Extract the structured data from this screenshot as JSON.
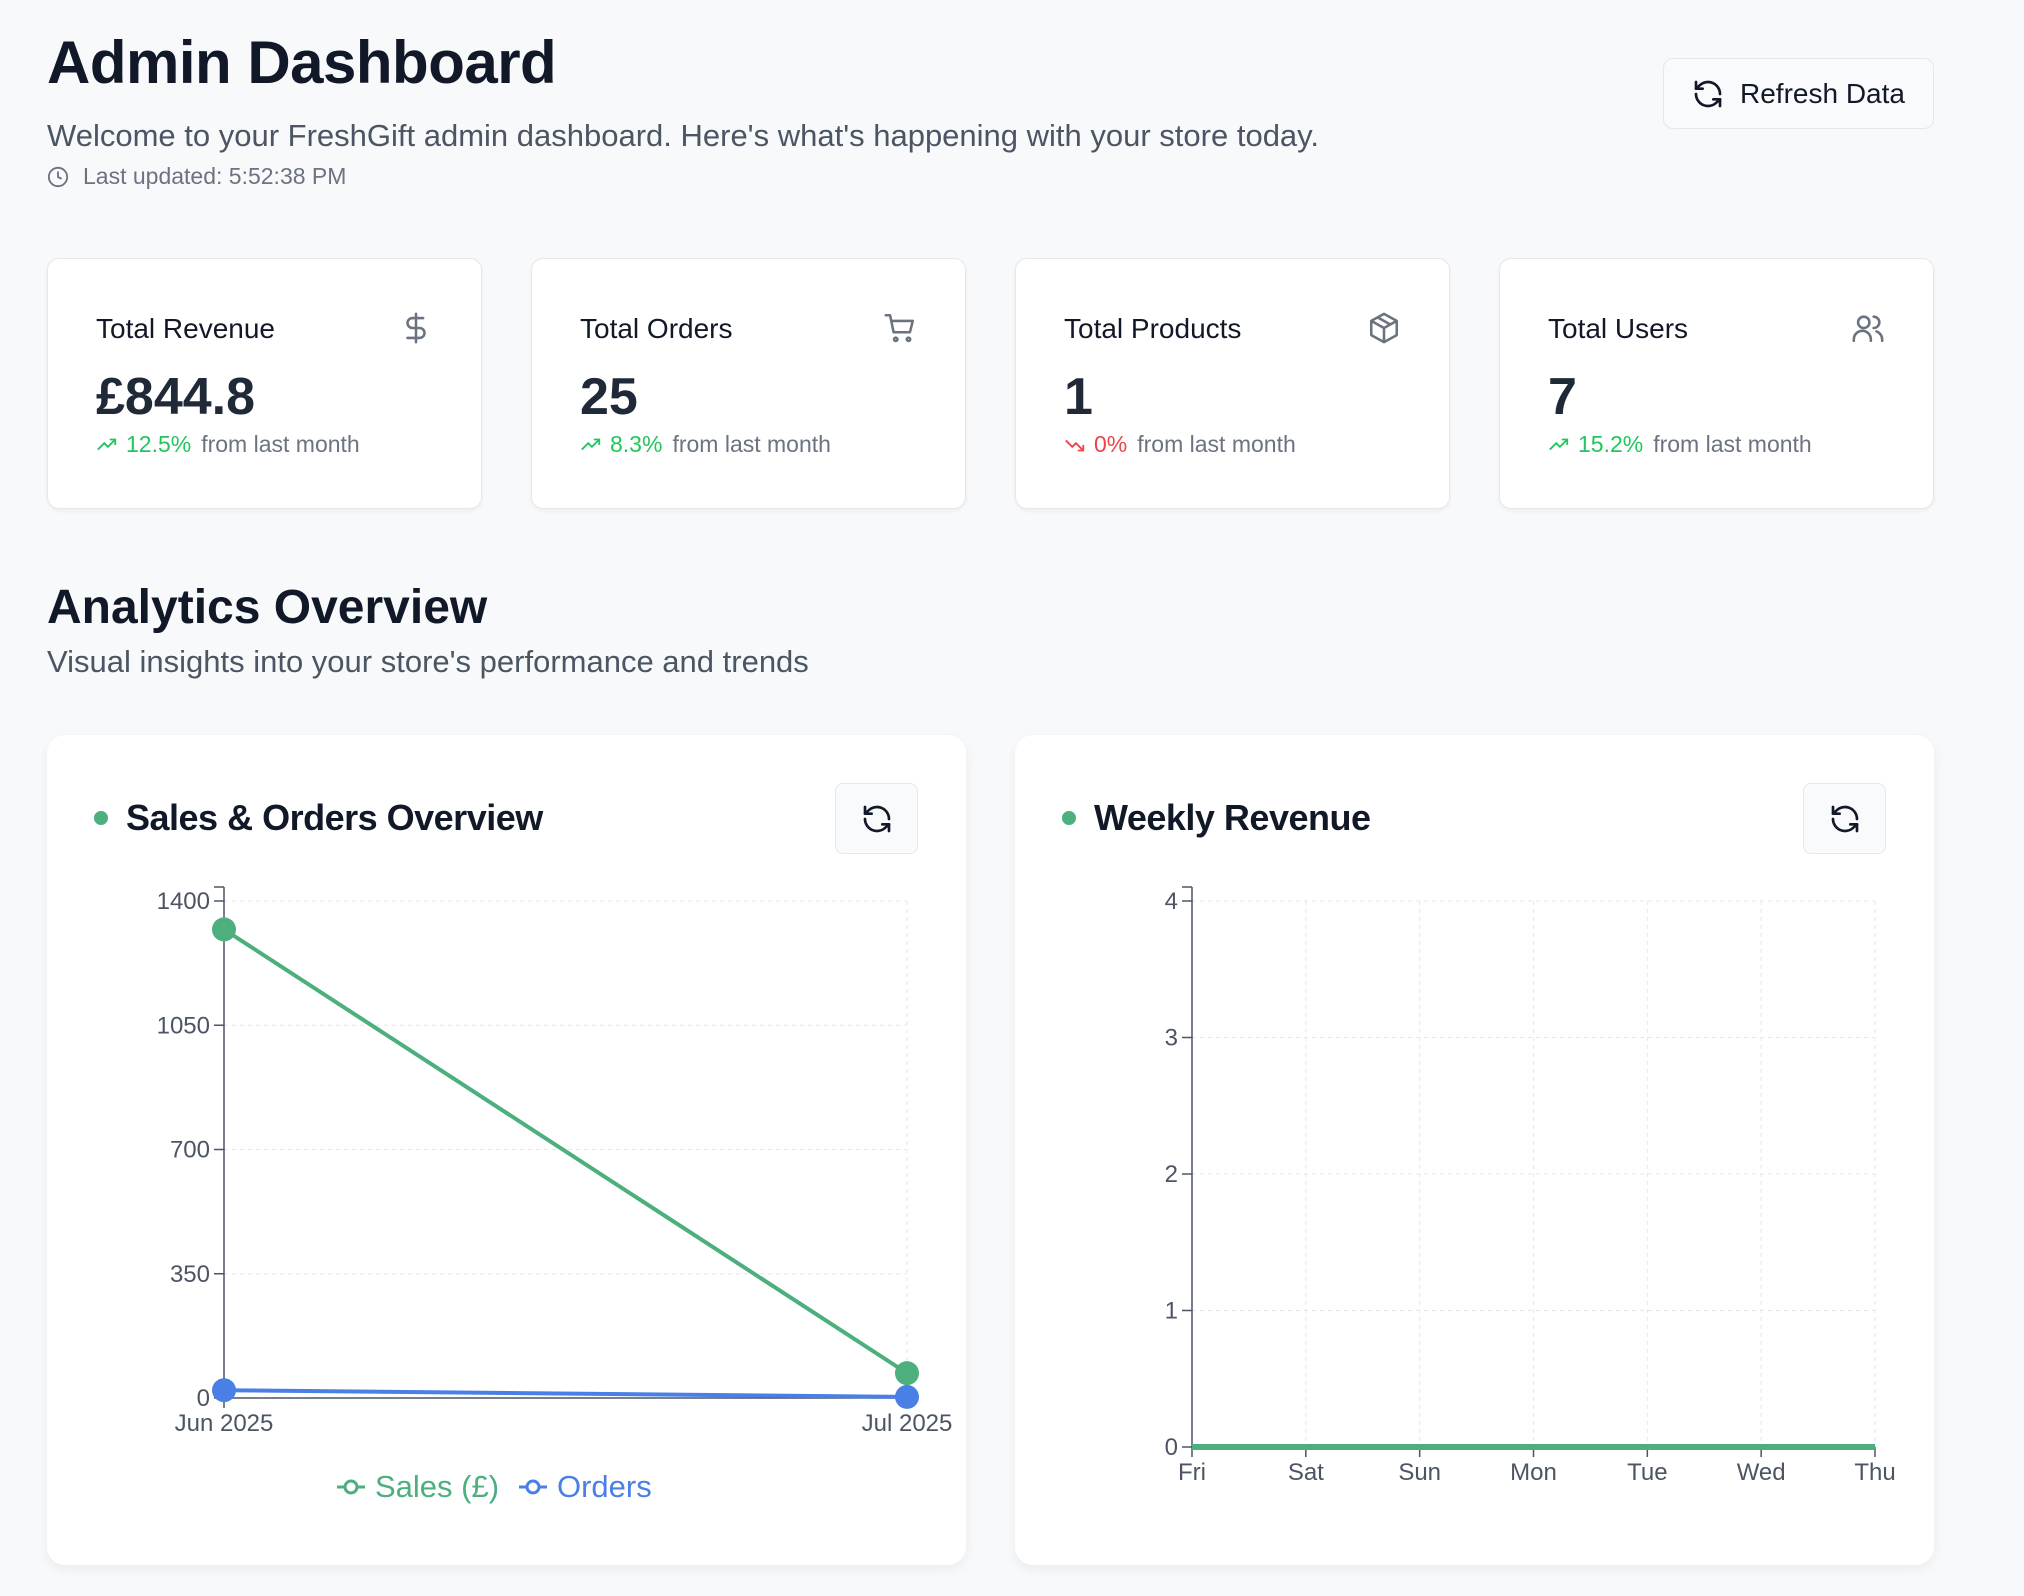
{
  "header": {
    "title": "Admin Dashboard",
    "subtitle": "Welcome to your FreshGift admin dashboard. Here's what's happening with your store today.",
    "last_updated": "Last updated: 5:52:38 PM",
    "refresh_label": "Refresh Data"
  },
  "stats": [
    {
      "title": "Total Revenue",
      "value": "£844.8",
      "change": "12.5%",
      "trend": "up",
      "suffix": "from last month",
      "icon": "dollar-icon"
    },
    {
      "title": "Total Orders",
      "value": "25",
      "change": "8.3%",
      "trend": "up",
      "suffix": "from last month",
      "icon": "cart-icon"
    },
    {
      "title": "Total Products",
      "value": "1",
      "change": "0%",
      "trend": "down",
      "suffix": "from last month",
      "icon": "package-icon"
    },
    {
      "title": "Total Users",
      "value": "7",
      "change": "15.2%",
      "trend": "up",
      "suffix": "from last month",
      "icon": "users-icon"
    }
  ],
  "analytics": {
    "title": "Analytics Overview",
    "subtitle": "Visual insights into your store's performance and trends"
  },
  "colors": {
    "sales": "#4caf7d",
    "orders": "#4a7fe6",
    "up": "#22c55e",
    "down": "#ef4444"
  },
  "chart_data": [
    {
      "type": "line",
      "title": "Sales & Orders Overview",
      "x": [
        "Jun 2025",
        "Jul 2025"
      ],
      "series": [
        {
          "name": "Sales (£)",
          "values": [
            1320,
            70
          ]
        },
        {
          "name": "Orders",
          "values": [
            22,
            3
          ]
        }
      ],
      "ylim": [
        0,
        1400
      ],
      "yticks": [
        0,
        350,
        700,
        1050,
        1400
      ],
      "grid": true,
      "legend": "bottom"
    },
    {
      "type": "line",
      "title": "Weekly Revenue",
      "x": [
        "Fri",
        "Sat",
        "Sun",
        "Mon",
        "Tue",
        "Wed",
        "Thu"
      ],
      "series": [
        {
          "values": [
            0,
            0,
            0,
            0,
            0,
            0,
            0
          ]
        }
      ],
      "ylim": [
        0,
        4
      ],
      "yticks": [
        0,
        1,
        2,
        3,
        4
      ],
      "grid": true
    }
  ]
}
